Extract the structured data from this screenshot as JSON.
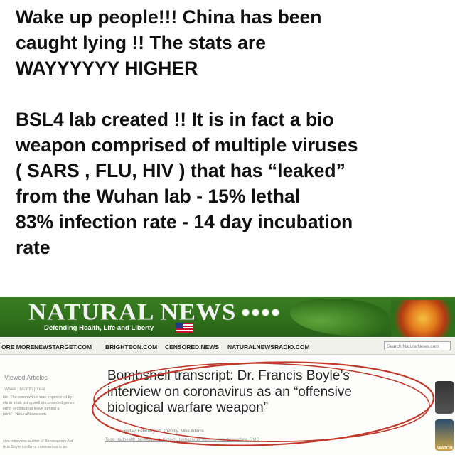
{
  "post": {
    "lines_a": [
      "Wake up people!!! China has been",
      "caught lying !! The stats are",
      "WAYYYYYY HIGHER"
    ],
    "lines_b": [
      "BSL4 lab created !! It is in fact a bio",
      "weapon comprised of multiple viruses",
      "( SARS , FLU, HIV ) that has “leaked”",
      "from the Wuhan lab  - 15% lethal",
      "83% infection rate - 14 day incubation",
      "rate"
    ]
  },
  "site": {
    "logo": "NATURAL NEWS",
    "tagline": "Defending Health, Life and Liberty",
    "nav": {
      "more": "ORE MORE:",
      "links": [
        "NEWSTARGET.COM",
        "BRIGHTEON.COM",
        "CENSORED.NEWS",
        "NATURALNEWSRADIO.COM"
      ],
      "search_placeholder": "Search NaturalNews.com"
    },
    "sidebar": {
      "heading": "Viewed Articles",
      "tabs": "Week | Month | Year",
      "snippet_1": "bie: The coronavirus was engineered by",
      "snippet_2": "ets in a lab using well documented genes",
      "snippet_3": "ering vectors that leave behind a",
      "snippet_4": "print\" - NaturalNews.com",
      "snippet_5": "sive interview, author of Bioweapons Act",
      "snippet_6": "ncis Boyle confirms coronavirus is an"
    },
    "article": {
      "headline_lines": [
        "Bombshell transcript: Dr. Francis Boyle’s",
        "interview on coronavirus as an “offensive",
        "biological warfare weapon”"
      ],
      "byline": "Tuesday, February 04, 2020 by: Mike Adams",
      "tags": "Tags: badhealth, bioweapons, biotech, biohazards, bioterrorism, biowarfare, GMO",
      "side_label": "WATCH"
    },
    "colors": {
      "banner_green": "#2f6f1b",
      "circle_red": "#c0392b"
    }
  }
}
